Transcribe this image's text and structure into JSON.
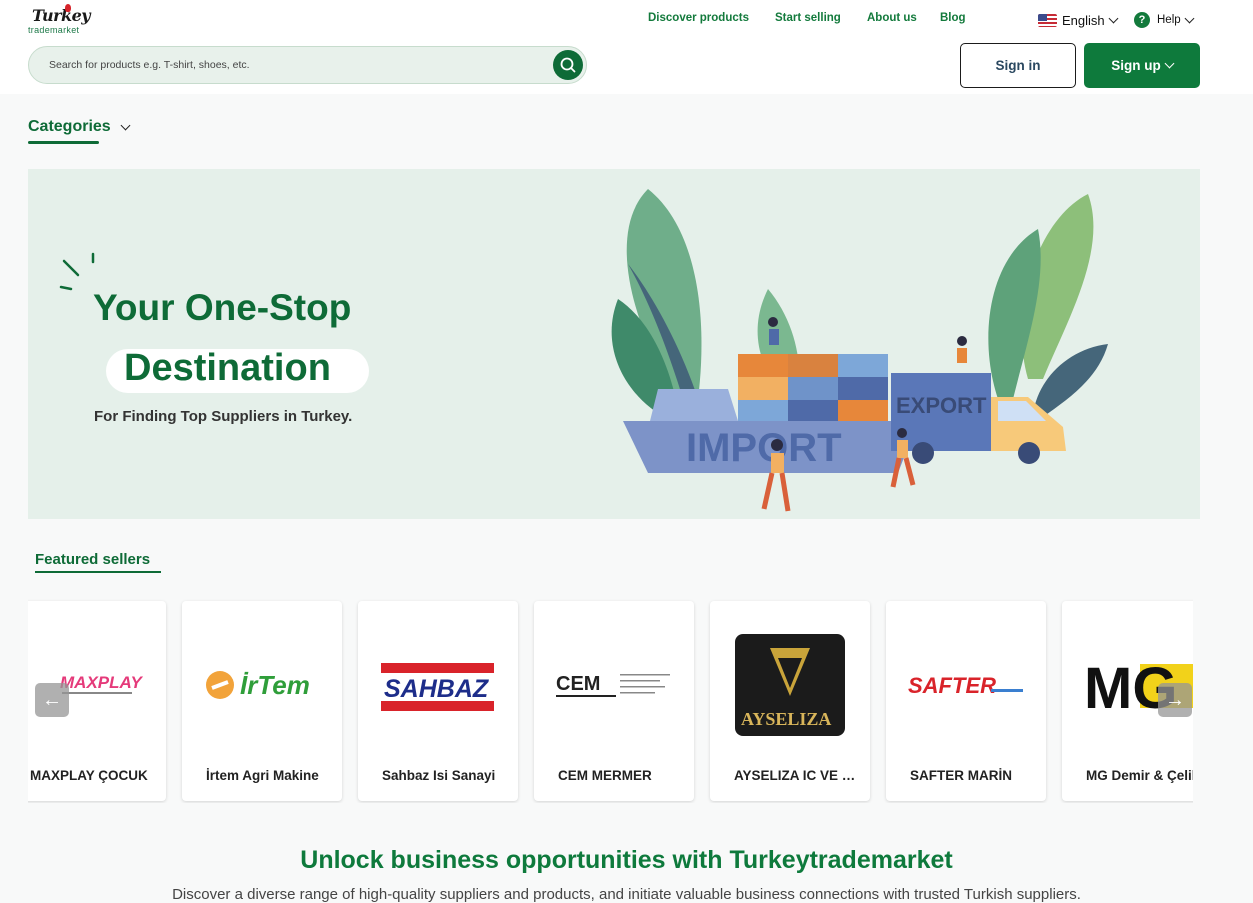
{
  "brand": {
    "name_top": "Turkey",
    "name_bottom": "trademarket"
  },
  "nav": {
    "items": [
      "Discover products",
      "Start selling",
      "About us",
      "Blog"
    ],
    "language": "English",
    "help": "Help",
    "help_icon": "?"
  },
  "search": {
    "placeholder": "Search for products e.g. T-shirt, shoes, etc."
  },
  "auth": {
    "sign_in": "Sign in",
    "sign_up": "Sign up"
  },
  "categories": {
    "label": "Categories"
  },
  "hero": {
    "title_line1": "Your One-Stop",
    "title_line2": "Destination",
    "subtitle": "For Finding Top Suppliers in Turkey.",
    "art_text_import": "IMPORT",
    "art_text_export": "EXPORT"
  },
  "featured": {
    "title": "Featured sellers",
    "sellers": [
      {
        "name": "MAXPLAY ÇOCUK",
        "logo_text": "MAXPLAY"
      },
      {
        "name": "İrtem Agri Makine",
        "logo_text": "İrTem"
      },
      {
        "name": "Sahbaz Isi Sanayi",
        "logo_text": "SAHBAZ"
      },
      {
        "name": "CEM MERMER",
        "logo_text": "CEM"
      },
      {
        "name": "AYSELIZA IC VE DIS",
        "logo_text": "AYSELIZA"
      },
      {
        "name": "SAFTER MARİN",
        "logo_text": "SAFTER"
      },
      {
        "name": "MG Demir & Çelik",
        "logo_text": "MG"
      }
    ],
    "prev_icon": "←",
    "next_icon": "→"
  },
  "unlock": {
    "title": "Unlock business opportunities with Turkeytrademarket",
    "text": "Discover a diverse range of high-quality suppliers and products, and initiate valuable business connections with trusted Turkish suppliers."
  },
  "colors": {
    "brand_green": "#0e7a3c",
    "hero_bg": "#e5f0ea"
  }
}
